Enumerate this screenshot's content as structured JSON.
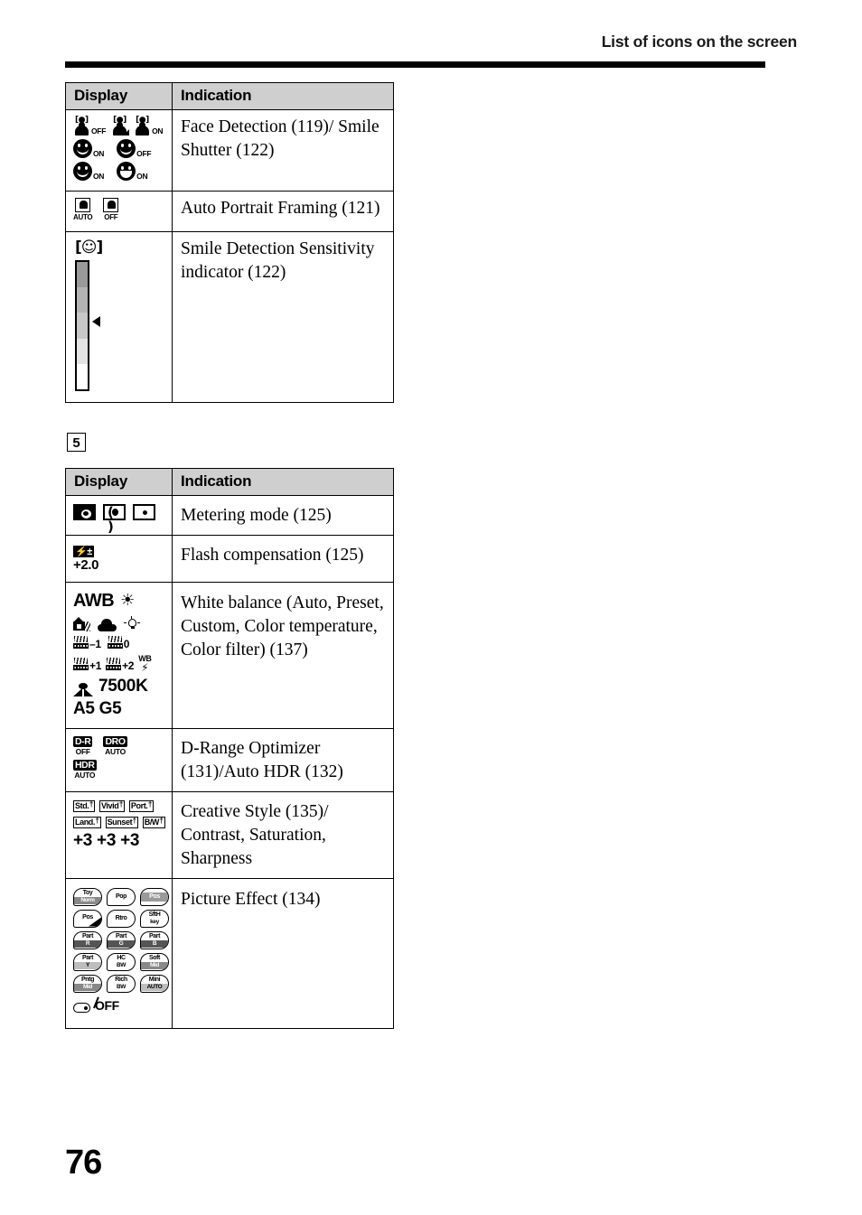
{
  "header": {
    "title": "List of icons on the screen"
  },
  "page_number": "76",
  "section_marker": "5",
  "table1": {
    "columns": {
      "display": "Display",
      "indication": "Indication"
    },
    "rows": [
      {
        "indication": "Face Detection (119)/ Smile Shutter (122)",
        "icons": {
          "face_off": "OFF",
          "face_registered": "",
          "face_on": "ON",
          "smile1": "ON",
          "smile2": "OFF",
          "smile3": "ON",
          "smile4": "ON"
        }
      },
      {
        "indication": "Auto Portrait Framing (121)",
        "icons": {
          "apf_auto": "AUTO",
          "apf_off": "OFF"
        }
      },
      {
        "indication": "Smile Detection Sensitivity indicator (122)",
        "icons": {
          "smile_bracket": "[☺]"
        },
        "sensitivity_levels": [
          "#9a9a9a",
          "#b4b4b4",
          "#c8c8c8",
          "#e4e4e4",
          "#ffffff"
        ],
        "marker_position_segment": 3
      }
    ]
  },
  "table2": {
    "columns": {
      "display": "Display",
      "indication": "Indication"
    },
    "rows": [
      {
        "indication": "Metering mode (125)",
        "icons": {
          "multi": "multi-metering-icon",
          "center": "center-weighted-icon",
          "spot": "spot-metering-icon"
        }
      },
      {
        "indication": "Flash compensation (125)",
        "icons": {
          "flash_badge": "⚡±",
          "value": "+2.0"
        }
      },
      {
        "indication": "White balance (Auto, Preset, Custom, Color temperature, Color filter) (137)",
        "icons": {
          "awb": "AWB",
          "daylight": "sun-icon",
          "shade": "shade-icon",
          "cloudy": "cloudy-icon",
          "incandescent": "incandescent-icon",
          "fluor_m1": "–1",
          "fluor_0": "0",
          "fluor_p1": "+1",
          "fluor_p2": "+2",
          "wb_flash_top": "WB",
          "wb_flash_bottom": "⚡",
          "color_temp": "7500K",
          "color_filter": "A5 G5"
        }
      },
      {
        "indication": "D-Range Optimizer (131)/Auto HDR (132)",
        "icons": {
          "dr_top": "D-R",
          "dr_bot": "OFF",
          "dro_top": "DRO",
          "dro_bot": "AUTO",
          "hdr_top": "HDR",
          "hdr_bot": "AUTO"
        }
      },
      {
        "indication": "Creative Style (135)/ Contrast, Saturation, Sharpness",
        "icons": {
          "chips": [
            "Std.",
            "Vivid",
            "Port.",
            "Land.",
            "Sunset",
            "B/W"
          ],
          "values": "+3 +3 +3"
        }
      },
      {
        "indication": "Picture Effect (134)",
        "icons": {
          "badges": [
            {
              "t1": "Toy",
              "t2": "Norm",
              "style": "fill-bot"
            },
            {
              "t1": "Pop",
              "t2": "",
              "style": ""
            },
            {
              "t1": "Pos",
              "t2": "",
              "style": "half-top"
            },
            {
              "t1": "Pos",
              "t2": "",
              "style": "corner"
            },
            {
              "t1": "Rtro",
              "t2": "",
              "style": ""
            },
            {
              "t1": "SftH",
              "t2": "key",
              "style": ""
            },
            {
              "t1": "Part",
              "t2": "R",
              "style": "fill-dark"
            },
            {
              "t1": "Part",
              "t2": "G",
              "style": "fill-dark"
            },
            {
              "t1": "Part",
              "t2": "B",
              "style": "fill-dark"
            },
            {
              "t1": "Part",
              "t2": "Y",
              "style": "fill-light"
            },
            {
              "t1": "HC",
              "t2": "BW",
              "style": ""
            },
            {
              "t1": "Soft",
              "t2": "Mid",
              "style": "fill-bot"
            },
            {
              "t1": "Pntg",
              "t2": "Mid",
              "style": "fill-bot"
            },
            {
              "t1": "Rich",
              "t2": "BW",
              "style": ""
            },
            {
              "t1": "Mini",
              "t2": "AUTO",
              "style": "fill-light"
            }
          ],
          "off_label": "OFF"
        }
      }
    ]
  }
}
